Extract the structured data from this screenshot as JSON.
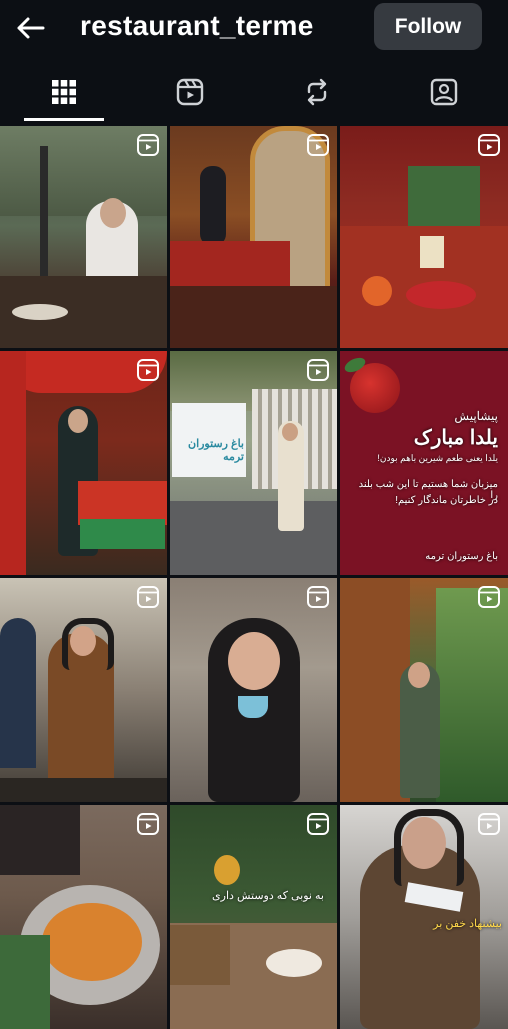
{
  "header": {
    "back_icon": "arrow-left-icon",
    "username": "restaurant_terme",
    "follow_label": "Follow"
  },
  "tabs": [
    {
      "name": "posts",
      "icon": "grid-icon",
      "active": true
    },
    {
      "name": "reels",
      "icon": "reels-icon",
      "active": false
    },
    {
      "name": "reposts",
      "icon": "repost-icon",
      "active": false
    },
    {
      "name": "tagged",
      "icon": "tagged-person-icon",
      "active": false
    }
  ],
  "posts": {
    "p6": {
      "line1": "پیشاپیش",
      "line2": "یلدا مبارک",
      "line3": "یلدا یعنی طعم شیرین باهم بودن!",
      "line4": "میزبان شما هستیم تا این شب بلند را",
      "line5": "در خاطرتان ماندگار کنیم!",
      "footer": "باغ رستوران ترمه"
    },
    "p5_sign": "باغ رستوران ترمه",
    "p11_caption": "به نوبی که دوستش داری",
    "p12_caption": "بیشنهاد خفن بر"
  },
  "colors": {
    "background": "#0c0f14",
    "follow_button": "#363a40",
    "yalda_card": "#7b1224"
  }
}
